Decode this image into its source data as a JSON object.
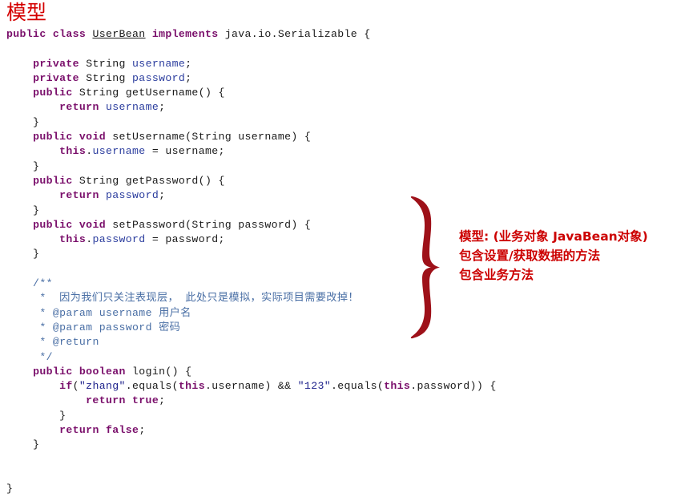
{
  "slide": {
    "title": "模型",
    "title_color": "#d40000",
    "background": "#ffffff"
  },
  "code": {
    "language": "java",
    "colors": {
      "keyword": "#7a0f6b",
      "identifier": "#1a1a1a",
      "field": "#2b3d9e",
      "string": "#1b1f8a",
      "comment": "#4a6fa5"
    },
    "lines": [
      [
        {
          "t": "public",
          "c": "kw"
        },
        {
          "t": " ",
          "c": "plain"
        },
        {
          "t": "class",
          "c": "kw"
        },
        {
          "t": " ",
          "c": "plain"
        },
        {
          "t": "UserBean",
          "c": "cls"
        },
        {
          "t": " ",
          "c": "plain"
        },
        {
          "t": "implements",
          "c": "kw"
        },
        {
          "t": " java.io.Serializable {",
          "c": "plain"
        }
      ],
      [],
      [
        {
          "t": "    ",
          "c": "plain"
        },
        {
          "t": "private",
          "c": "kw"
        },
        {
          "t": " ",
          "c": "plain"
        },
        {
          "t": "String",
          "c": "typ"
        },
        {
          "t": " ",
          "c": "plain"
        },
        {
          "t": "username",
          "c": "fld"
        },
        {
          "t": ";",
          "c": "plain"
        }
      ],
      [
        {
          "t": "    ",
          "c": "plain"
        },
        {
          "t": "private",
          "c": "kw"
        },
        {
          "t": " ",
          "c": "plain"
        },
        {
          "t": "String",
          "c": "typ"
        },
        {
          "t": " ",
          "c": "plain"
        },
        {
          "t": "password",
          "c": "fld"
        },
        {
          "t": ";",
          "c": "plain"
        }
      ],
      [
        {
          "t": "    ",
          "c": "plain"
        },
        {
          "t": "public",
          "c": "kw"
        },
        {
          "t": " ",
          "c": "plain"
        },
        {
          "t": "String",
          "c": "typ"
        },
        {
          "t": " getUsername() {",
          "c": "plain"
        }
      ],
      [
        {
          "t": "        ",
          "c": "plain"
        },
        {
          "t": "return",
          "c": "kw"
        },
        {
          "t": " ",
          "c": "plain"
        },
        {
          "t": "username",
          "c": "fld"
        },
        {
          "t": ";",
          "c": "plain"
        }
      ],
      [
        {
          "t": "    }",
          "c": "plain"
        }
      ],
      [
        {
          "t": "    ",
          "c": "plain"
        },
        {
          "t": "public",
          "c": "kw"
        },
        {
          "t": " ",
          "c": "plain"
        },
        {
          "t": "void",
          "c": "kw"
        },
        {
          "t": " setUsername(String username) {",
          "c": "plain"
        }
      ],
      [
        {
          "t": "        ",
          "c": "plain"
        },
        {
          "t": "this",
          "c": "kw"
        },
        {
          "t": ".",
          "c": "plain"
        },
        {
          "t": "username",
          "c": "fld"
        },
        {
          "t": " = username;",
          "c": "plain"
        }
      ],
      [
        {
          "t": "    }",
          "c": "plain"
        }
      ],
      [
        {
          "t": "    ",
          "c": "plain"
        },
        {
          "t": "public",
          "c": "kw"
        },
        {
          "t": " ",
          "c": "plain"
        },
        {
          "t": "String",
          "c": "typ"
        },
        {
          "t": " getPassword() {",
          "c": "plain"
        }
      ],
      [
        {
          "t": "        ",
          "c": "plain"
        },
        {
          "t": "return",
          "c": "kw"
        },
        {
          "t": " ",
          "c": "plain"
        },
        {
          "t": "password",
          "c": "fld"
        },
        {
          "t": ";",
          "c": "plain"
        }
      ],
      [
        {
          "t": "    }",
          "c": "plain"
        }
      ],
      [
        {
          "t": "    ",
          "c": "plain"
        },
        {
          "t": "public",
          "c": "kw"
        },
        {
          "t": " ",
          "c": "plain"
        },
        {
          "t": "void",
          "c": "kw"
        },
        {
          "t": " setPassword(String password) {",
          "c": "plain"
        }
      ],
      [
        {
          "t": "        ",
          "c": "plain"
        },
        {
          "t": "this",
          "c": "kw"
        },
        {
          "t": ".",
          "c": "plain"
        },
        {
          "t": "password",
          "c": "fld"
        },
        {
          "t": " = password;",
          "c": "plain"
        }
      ],
      [
        {
          "t": "    }",
          "c": "plain"
        }
      ],
      [],
      [
        {
          "t": "    /**",
          "c": "cmt"
        }
      ],
      [
        {
          "t": "     *  ",
          "c": "cmt"
        },
        {
          "t": "因为我们只关注表现层， 此处只是模拟，实际项目需要改掉！",
          "c": "cmt cn"
        }
      ],
      [
        {
          "t": "     * ",
          "c": "cmt"
        },
        {
          "t": "@param",
          "c": "cmt tag"
        },
        {
          "t": " username ",
          "c": "cmt"
        },
        {
          "t": "用户名",
          "c": "cmt cn"
        }
      ],
      [
        {
          "t": "     * ",
          "c": "cmt"
        },
        {
          "t": "@param",
          "c": "cmt tag"
        },
        {
          "t": " password ",
          "c": "cmt"
        },
        {
          "t": "密码",
          "c": "cmt cn"
        }
      ],
      [
        {
          "t": "     * ",
          "c": "cmt"
        },
        {
          "t": "@return",
          "c": "cmt tag"
        }
      ],
      [
        {
          "t": "     */",
          "c": "cmt"
        }
      ],
      [
        {
          "t": "    ",
          "c": "plain"
        },
        {
          "t": "public",
          "c": "kw"
        },
        {
          "t": " ",
          "c": "plain"
        },
        {
          "t": "boolean",
          "c": "kw"
        },
        {
          "t": " login() {",
          "c": "plain"
        }
      ],
      [
        {
          "t": "        ",
          "c": "plain"
        },
        {
          "t": "if",
          "c": "kw"
        },
        {
          "t": "(",
          "c": "plain"
        },
        {
          "t": "\"zhang\"",
          "c": "str"
        },
        {
          "t": ".equals(",
          "c": "plain"
        },
        {
          "t": "this",
          "c": "kw"
        },
        {
          "t": ".username) && ",
          "c": "plain"
        },
        {
          "t": "\"123\"",
          "c": "str"
        },
        {
          "t": ".equals(",
          "c": "plain"
        },
        {
          "t": "this",
          "c": "kw"
        },
        {
          "t": ".password)) {",
          "c": "plain"
        }
      ],
      [
        {
          "t": "            ",
          "c": "plain"
        },
        {
          "t": "return",
          "c": "kw"
        },
        {
          "t": " ",
          "c": "plain"
        },
        {
          "t": "true",
          "c": "kw"
        },
        {
          "t": ";",
          "c": "plain"
        }
      ],
      [
        {
          "t": "        }",
          "c": "plain"
        }
      ],
      [
        {
          "t": "        ",
          "c": "plain"
        },
        {
          "t": "return",
          "c": "kw"
        },
        {
          "t": " ",
          "c": "plain"
        },
        {
          "t": "false",
          "c": "kw"
        },
        {
          "t": ";",
          "c": "plain"
        }
      ],
      [
        {
          "t": "    }",
          "c": "plain"
        }
      ],
      [],
      [],
      [
        {
          "t": "}",
          "c": "plain"
        }
      ]
    ]
  },
  "annotation": {
    "brace_color": "#9e1119",
    "text_color": "#cc0000",
    "lines": [
      "模型: (业务对象 JavaBean对象)",
      "包含设置/获取数据的方法",
      "包含业务方法"
    ]
  }
}
